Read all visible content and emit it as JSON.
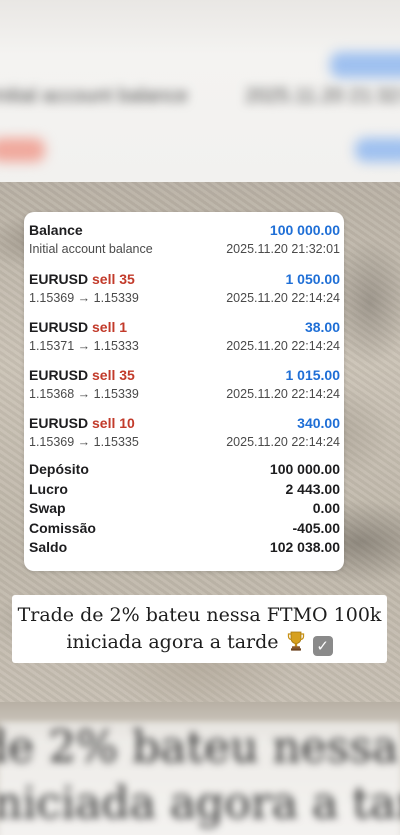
{
  "entries": [
    {
      "title": "Balance",
      "action": "",
      "amount": "100 000.00",
      "detail": "Initial account balance",
      "time": "2025.11.20 21:32:01"
    },
    {
      "title": "EURUSD",
      "action": "sell 35",
      "amount": "1 050.00",
      "detail": "1.15369 → 1.15339",
      "time": "2025.11.20 22:14:24"
    },
    {
      "title": "EURUSD",
      "action": "sell 1",
      "amount": "38.00",
      "detail": "1.15371 → 1.15333",
      "time": "2025.11.20 22:14:24"
    },
    {
      "title": "EURUSD",
      "action": "sell 35",
      "amount": "1 015.00",
      "detail": "1.15368 → 1.15339",
      "time": "2025.11.20 22:14:24"
    },
    {
      "title": "EURUSD",
      "action": "sell 10",
      "amount": "340.00",
      "detail": "1.15369 → 1.15335",
      "time": "2025.11.20 22:14:24"
    }
  ],
  "summary": [
    {
      "label": "Depósito",
      "value": "100 000.00"
    },
    {
      "label": "Lucro",
      "value": "2 443.00"
    },
    {
      "label": "Swap",
      "value": "0.00"
    },
    {
      "label": "Comissão",
      "value": "-405.00"
    },
    {
      "label": "Saldo",
      "value": "102 038.00"
    }
  ],
  "caption": {
    "line1": "Trade de 2% bateu nessa FTMO 100k",
    "line2": "iniciada agora a tarde",
    "trophy_icon": "trophy-icon",
    "check_icon": "check-mark-button-icon",
    "check_glyph": "✓"
  },
  "colors": {
    "amount_blue": "#1f6fd6",
    "sell_red": "#c23a2a"
  }
}
